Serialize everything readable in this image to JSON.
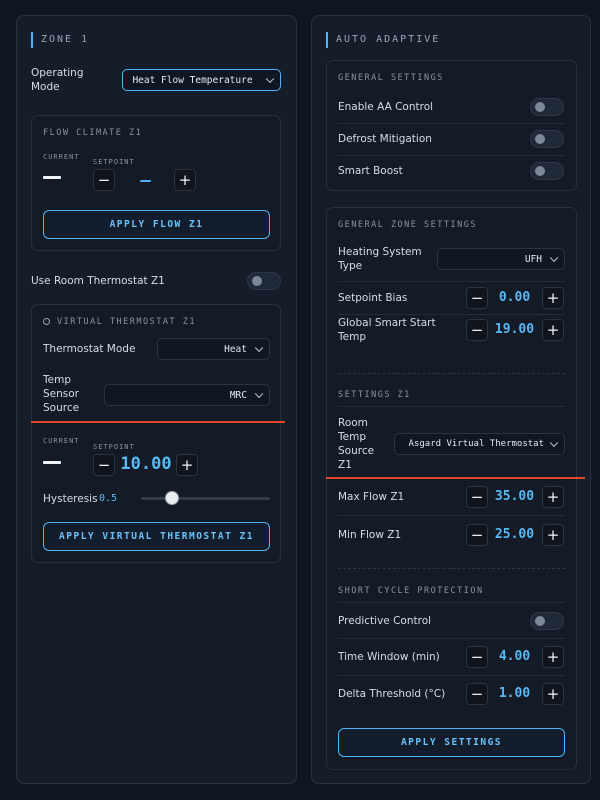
{
  "zone1": {
    "title": "ZONE 1",
    "operating_mode_label": "Operating Mode",
    "operating_mode_value": "Heat Flow Temperature",
    "flow_climate": {
      "title": "FLOW CLIMATE Z1",
      "current_label": "CURRENT",
      "setpoint_label": "SETPOINT",
      "minus": "−",
      "plus": "+",
      "apply_label": "APPLY FLOW Z1"
    },
    "room_thermostat_label": "Use Room Thermostat Z1",
    "virtual_thermostat": {
      "title": "VIRTUAL THERMOSTAT Z1",
      "mode_label": "Thermostat Mode",
      "mode_value": "Heat",
      "sensor_label": "Temp Sensor Source",
      "sensor_value": "MRC",
      "current_label": "CURRENT",
      "setpoint_label": "SETPOINT",
      "setpoint_value": "10.00",
      "minus": "−",
      "plus": "+",
      "hysteresis_label": "Hysteresis",
      "hysteresis_value": "0.5",
      "apply_label": "APPLY VIRTUAL THERMOSTAT Z1"
    }
  },
  "auto_adaptive": {
    "title": "AUTO ADAPTIVE",
    "general_settings": {
      "title": "GENERAL SETTINGS",
      "enable_aa_label": "Enable AA Control",
      "defrost_label": "Defrost Mitigation",
      "smart_boost_label": "Smart Boost"
    },
    "general_zone_settings": {
      "title": "GENERAL ZONE SETTINGS",
      "heating_system_label": "Heating System Type",
      "heating_system_value": "UFH",
      "setpoint_bias_label": "Setpoint Bias",
      "setpoint_bias_value": "0.00",
      "global_smart_start_label": "Global Smart Start Temp",
      "global_smart_start_value": "19.00",
      "settings_z1_title": "SETTINGS Z1",
      "room_temp_source_label": "Room Temp Source Z1",
      "room_temp_source_value": "Asgard Virtual Thermostat",
      "max_flow_label": "Max Flow Z1",
      "max_flow_value": "35.00",
      "min_flow_label": "Min Flow Z1",
      "min_flow_value": "25.00",
      "short_cycle_title": "SHORT CYCLE PROTECTION",
      "predictive_label": "Predictive Control",
      "time_window_label": "Time Window (min)",
      "time_window_value": "4.00",
      "delta_threshold_label": "Delta Threshold (°C)",
      "delta_threshold_value": "1.00",
      "minus": "−",
      "plus": "+",
      "apply_label": "APPLY SETTINGS"
    }
  },
  "colors": {
    "accent": "#4fb3f7",
    "background": "#111722",
    "panel": "#161d2a",
    "marker": "#e1492a"
  }
}
